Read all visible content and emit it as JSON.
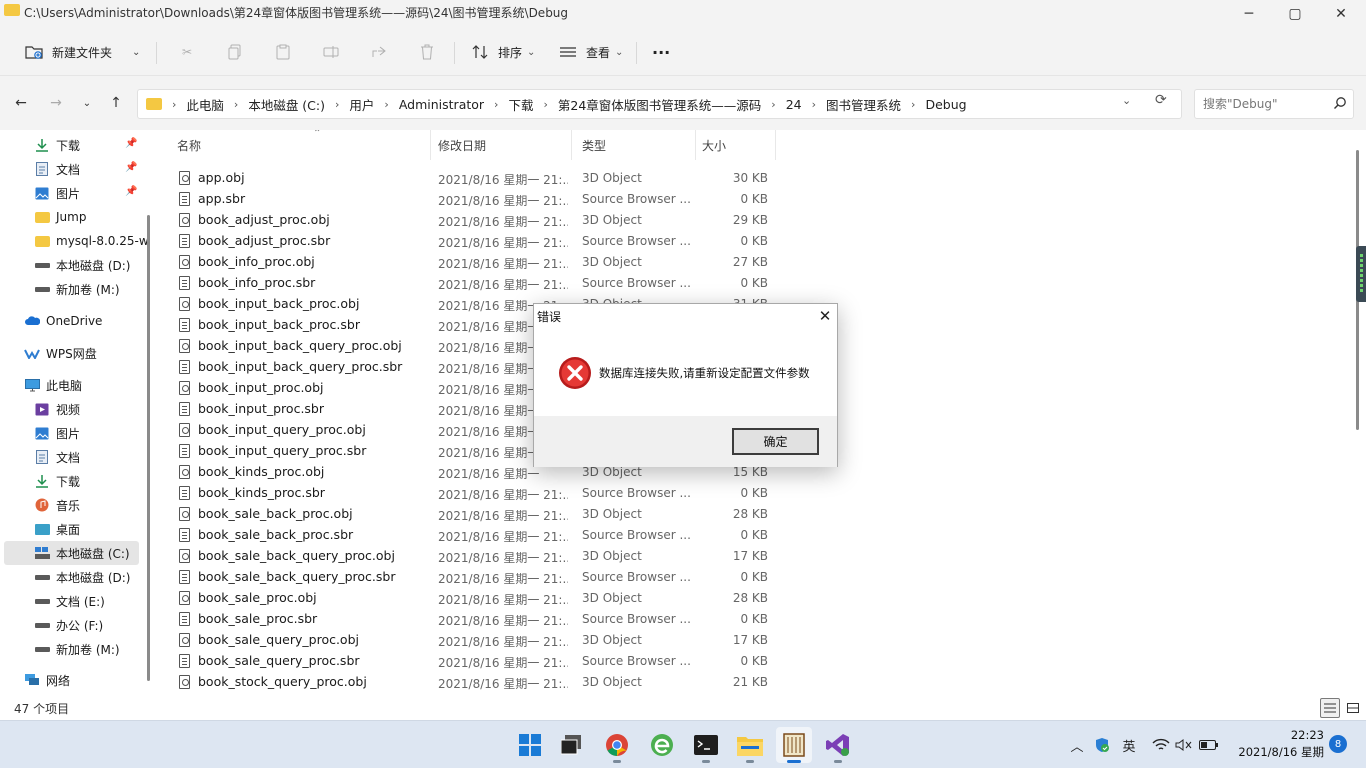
{
  "window": {
    "title": "C:\\Users\\Administrator\\Downloads\\第24章窗体版图书管理系统——源码\\24\\图书管理系统\\Debug",
    "minimize": "─",
    "maximize": "▢",
    "close": "✕"
  },
  "toolbar": {
    "new_folder": "新建文件夹",
    "sort": "排序",
    "view": "查看",
    "more": "···"
  },
  "address": {
    "crumbs": [
      "此电脑",
      "本地磁盘 (C:)",
      "用户",
      "Administrator",
      "下载",
      "第24章窗体版图书管理系统——源码",
      "24",
      "图书管理系统",
      "Debug"
    ],
    "search_placeholder": "搜索\"Debug\""
  },
  "sidebar": {
    "items": [
      {
        "label": "下载",
        "icon": "download-icon",
        "pinned": true
      },
      {
        "label": "文档",
        "icon": "document-icon",
        "pinned": true
      },
      {
        "label": "图片",
        "icon": "picture-icon",
        "pinned": true
      },
      {
        "label": "Jump",
        "icon": "folder-icon"
      },
      {
        "label": "mysql-8.0.25-w",
        "icon": "folder-icon"
      },
      {
        "label": "本地磁盘 (D:)",
        "icon": "drive-icon"
      },
      {
        "label": "新加卷 (M:)",
        "icon": "drive-icon"
      },
      {
        "label": "OneDrive",
        "icon": "onedrive-icon"
      },
      {
        "label": "WPS网盘",
        "icon": "wps-cloud-icon"
      },
      {
        "label": "此电脑",
        "icon": "computer-icon"
      },
      {
        "label": "视频",
        "icon": "video-icon"
      },
      {
        "label": "图片",
        "icon": "picture-icon"
      },
      {
        "label": "文档",
        "icon": "document-icon"
      },
      {
        "label": "下载",
        "icon": "download-icon"
      },
      {
        "label": "音乐",
        "icon": "music-icon"
      },
      {
        "label": "桌面",
        "icon": "desktop-icon"
      },
      {
        "label": "本地磁盘 (C:)",
        "icon": "drive-icon",
        "selected": true
      },
      {
        "label": "本地磁盘 (D:)",
        "icon": "drive-icon"
      },
      {
        "label": "文档 (E:)",
        "icon": "drive-icon"
      },
      {
        "label": "办公 (F:)",
        "icon": "drive-icon"
      },
      {
        "label": "新加卷 (M:)",
        "icon": "drive-icon"
      },
      {
        "label": "网络",
        "icon": "network-icon"
      }
    ]
  },
  "filelist": {
    "columns": {
      "name": "名称",
      "date": "修改日期",
      "type": "类型",
      "size": "大小"
    },
    "rows": [
      {
        "name": "app.obj",
        "date": "2021/8/16 星期一 21:...",
        "type": "3D Object",
        "size": "30 KB",
        "kind": "obj"
      },
      {
        "name": "app.sbr",
        "date": "2021/8/16 星期一 21:...",
        "type": "Source Browser ...",
        "size": "0 KB",
        "kind": "sbr"
      },
      {
        "name": "book_adjust_proc.obj",
        "date": "2021/8/16 星期一 21:...",
        "type": "3D Object",
        "size": "29 KB",
        "kind": "obj"
      },
      {
        "name": "book_adjust_proc.sbr",
        "date": "2021/8/16 星期一 21:...",
        "type": "Source Browser ...",
        "size": "0 KB",
        "kind": "sbr"
      },
      {
        "name": "book_info_proc.obj",
        "date": "2021/8/16 星期一 21:...",
        "type": "3D Object",
        "size": "27 KB",
        "kind": "obj"
      },
      {
        "name": "book_info_proc.sbr",
        "date": "2021/8/16 星期一 21:...",
        "type": "Source Browser ...",
        "size": "0 KB",
        "kind": "sbr"
      },
      {
        "name": "book_input_back_proc.obj",
        "date": "2021/8/16 星期一 21:...",
        "type": "3D Object",
        "size": "31 KB",
        "kind": "obj"
      },
      {
        "name": "book_input_back_proc.sbr",
        "date": "2021/8/16 星期一",
        "type": "",
        "size": "",
        "kind": "sbr"
      },
      {
        "name": "book_input_back_query_proc.obj",
        "date": "2021/8/16 星期一",
        "type": "",
        "size": "",
        "kind": "obj"
      },
      {
        "name": "book_input_back_query_proc.sbr",
        "date": "2021/8/16 星期一",
        "type": "",
        "size": "",
        "kind": "sbr"
      },
      {
        "name": "book_input_proc.obj",
        "date": "2021/8/16 星期一",
        "type": "",
        "size": "",
        "kind": "obj"
      },
      {
        "name": "book_input_proc.sbr",
        "date": "2021/8/16 星期一",
        "type": "",
        "size": "",
        "kind": "sbr"
      },
      {
        "name": "book_input_query_proc.obj",
        "date": "2021/8/16 星期一",
        "type": "",
        "size": "",
        "kind": "obj"
      },
      {
        "name": "book_input_query_proc.sbr",
        "date": "2021/8/16 星期一",
        "type": "",
        "size": "",
        "kind": "sbr"
      },
      {
        "name": "book_kinds_proc.obj",
        "date": "2021/8/16 星期一",
        "type": "3D Object",
        "size": "15 KB",
        "kind": "obj"
      },
      {
        "name": "book_kinds_proc.sbr",
        "date": "2021/8/16 星期一 21:...",
        "type": "Source Browser ...",
        "size": "0 KB",
        "kind": "sbr"
      },
      {
        "name": "book_sale_back_proc.obj",
        "date": "2021/8/16 星期一 21:...",
        "type": "3D Object",
        "size": "28 KB",
        "kind": "obj"
      },
      {
        "name": "book_sale_back_proc.sbr",
        "date": "2021/8/16 星期一 21:...",
        "type": "Source Browser ...",
        "size": "0 KB",
        "kind": "sbr"
      },
      {
        "name": "book_sale_back_query_proc.obj",
        "date": "2021/8/16 星期一 21:...",
        "type": "3D Object",
        "size": "17 KB",
        "kind": "obj"
      },
      {
        "name": "book_sale_back_query_proc.sbr",
        "date": "2021/8/16 星期一 21:...",
        "type": "Source Browser ...",
        "size": "0 KB",
        "kind": "sbr"
      },
      {
        "name": "book_sale_proc.obj",
        "date": "2021/8/16 星期一 21:...",
        "type": "3D Object",
        "size": "28 KB",
        "kind": "obj"
      },
      {
        "name": "book_sale_proc.sbr",
        "date": "2021/8/16 星期一 21:...",
        "type": "Source Browser ...",
        "size": "0 KB",
        "kind": "sbr"
      },
      {
        "name": "book_sale_query_proc.obj",
        "date": "2021/8/16 星期一 21:...",
        "type": "3D Object",
        "size": "17 KB",
        "kind": "obj"
      },
      {
        "name": "book_sale_query_proc.sbr",
        "date": "2021/8/16 星期一 21:...",
        "type": "Source Browser ...",
        "size": "0 KB",
        "kind": "sbr"
      },
      {
        "name": "book_stock_query_proc.obj",
        "date": "2021/8/16 星期一 21:...",
        "type": "3D Object",
        "size": "21 KB",
        "kind": "obj"
      }
    ]
  },
  "status": {
    "item_count": "47 个项目"
  },
  "dialog": {
    "title": "错误",
    "message": "数据库连接失败,请重新设定配置文件参数",
    "ok": "确定",
    "close": "✕"
  },
  "taskbar": {
    "ime": "英",
    "time": "22:23",
    "date": "2021/8/16 星期一",
    "notifications": "8"
  },
  "colors": {
    "accent": "#1a6fd1",
    "folder": "#f4c842",
    "error_red": "#d32f2f",
    "chrome_bg": "#f3f3f3",
    "taskbar_bg": "#dde6f2"
  }
}
